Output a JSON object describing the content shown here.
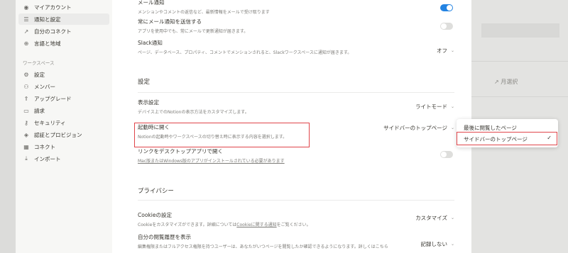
{
  "background": {
    "right_select_label": "月選択"
  },
  "sidebar": {
    "items": [
      {
        "label": "マイアカウント",
        "icon": "account-icon"
      },
      {
        "label": "通知と設定",
        "icon": "settings-sliders-icon"
      },
      {
        "label": "自分のコネクト",
        "icon": "connect-icon"
      },
      {
        "label": "言語と地域",
        "icon": "globe-icon"
      }
    ],
    "workspace_header": "ワークスペース",
    "workspace_items": [
      {
        "label": "設定",
        "icon": "gear-icon"
      },
      {
        "label": "メンバー",
        "icon": "members-icon"
      },
      {
        "label": "アップグレード",
        "icon": "upgrade-icon"
      },
      {
        "label": "請求",
        "icon": "card-icon"
      },
      {
        "label": "セキュリティ",
        "icon": "key-icon"
      },
      {
        "label": "認証とプロビジョン",
        "icon": "shield-icon"
      },
      {
        "label": "コネクト",
        "icon": "grid-icon"
      },
      {
        "label": "インポート",
        "icon": "download-icon"
      }
    ]
  },
  "notifications": {
    "email_partial_title": "メール通知",
    "email_partial_desc": "メンションやコメントの返信など、最新情報をメールで受け取ります",
    "always_email_title": "常にメール通知を送信する",
    "always_email_desc": "アプリを使用中でも、常にメールで更新通知が届きます。",
    "slack_title": "Slack通知",
    "slack_desc": "ページ、データベース、プロパティ、コメントでメンションされると、Slackワークスペースに通知が届きます。",
    "slack_value": "オフ"
  },
  "settings": {
    "section_title": "設定",
    "display_title": "表示設定",
    "display_desc": "デバイス上でのNotionの表示方法をカスタマイズします。",
    "display_value": "ライトモード",
    "startup_title": "起動時に開く",
    "startup_desc": "Notionの起動時やワークスペースの切り替え時に表示する内容を選択します。",
    "startup_value": "サイドバーのトップページ",
    "desktop_link_title": "リンクをデスクトップアプリで開く",
    "desktop_link_desc": "Mac版またはWindows版のアプリがインストールされている必要があります"
  },
  "privacy": {
    "section_title": "プライバシー",
    "cookie_title": "Cookieの設定",
    "cookie_desc_pre": "Cookieをカスタマイズができます。詳細については",
    "cookie_desc_link": "Cookieに関する通知",
    "cookie_desc_post": "をご覧ください。",
    "cookie_value": "カスタマイズ",
    "history_title": "自分の閲覧履歴を表示",
    "history_desc": "編集権限またはフルアクセス権限を持つユーザーは、あなたがいつページを閲覧したか確認できるようになります。詳しくはこちら",
    "history_value": "記録しない"
  },
  "dropdown": {
    "options": [
      {
        "label": "最後に閲覧したページ",
        "selected": false
      },
      {
        "label": "サイドバーのトップページ",
        "selected": true
      }
    ]
  },
  "colors": {
    "accent": "#2383e2",
    "highlight": "#e0454a"
  }
}
